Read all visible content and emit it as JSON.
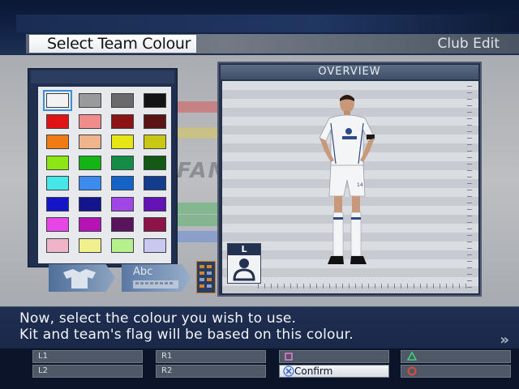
{
  "header": {
    "title": "Select Team Colour",
    "section": "Club Edit"
  },
  "palette": {
    "selected_index": 0,
    "swatches": [
      "#f2f2f2",
      "#9a9a9a",
      "#6a6a6a",
      "#141414",
      "#e01414",
      "#f08c8c",
      "#8c1414",
      "#5a1414",
      "#f07a14",
      "#f0b48c",
      "#e6e614",
      "#c8c814",
      "#8ce614",
      "#14b414",
      "#148c46",
      "#145a14",
      "#46e6e6",
      "#3c8cf0",
      "#1464c8",
      "#143c8c",
      "#1414c8",
      "#14148c",
      "#a046e6",
      "#6414b4",
      "#e646e6",
      "#b414b4",
      "#5a145a",
      "#8c1446",
      "#f0b4c8",
      "#f0f08c",
      "#b4f08c",
      "#c8c8f0"
    ]
  },
  "overview": {
    "title": "OVERVIEW",
    "badge_letter": "L",
    "badge_icon": "left-foot-icon"
  },
  "icons": {
    "icon2_label": "Abc"
  },
  "message": {
    "line1": "Now, select the colour you wish to use.",
    "line2": "Kit and team's flag will be based on this colour."
  },
  "legend": {
    "l1": "L1",
    "l2": "L2",
    "r1": "R1",
    "r2": "R2",
    "square_icon": "square-button-icon",
    "cross_icon": "cross-button-icon",
    "triangle_icon": "triangle-button-icon",
    "circle_icon": "circle-button-icon",
    "confirm": "Confirm"
  },
  "faded_logo": "FAM"
}
